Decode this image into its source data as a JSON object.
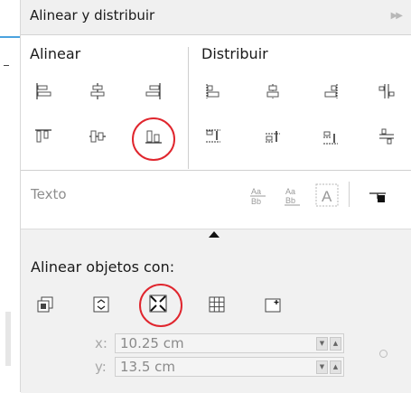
{
  "panel": {
    "title": "Alinear y distribuir",
    "collapse_icon": "chevrons-right-icon"
  },
  "sections": {
    "align_label": "Alinear",
    "distribute_label": "Distribuir",
    "text_label": "Texto",
    "align_with_label": "Alinear objetos con:"
  },
  "align_buttons": [
    {
      "name": "align-left",
      "icon": "align-left-icon"
    },
    {
      "name": "align-center-horizontal",
      "icon": "align-center-horizontal-icon"
    },
    {
      "name": "align-right",
      "icon": "align-right-icon"
    },
    {
      "name": "align-top",
      "icon": "align-top-icon"
    },
    {
      "name": "align-center-vertical",
      "icon": "align-center-vertical-icon"
    },
    {
      "name": "align-bottom",
      "icon": "align-bottom-icon",
      "highlighted": true
    }
  ],
  "distribute_buttons": [
    {
      "name": "distribute-left",
      "icon": "distribute-left-icon"
    },
    {
      "name": "distribute-center-h",
      "icon": "distribute-center-horizontal-icon"
    },
    {
      "name": "distribute-right",
      "icon": "distribute-right-icon"
    },
    {
      "name": "distribute-spacing-h",
      "icon": "distribute-spacing-horizontal-icon"
    },
    {
      "name": "distribute-top",
      "icon": "distribute-top-icon"
    },
    {
      "name": "distribute-center-v",
      "icon": "distribute-center-vertical-icon"
    },
    {
      "name": "distribute-bottom",
      "icon": "distribute-bottom-icon"
    },
    {
      "name": "distribute-spacing-v",
      "icon": "distribute-spacing-vertical-icon"
    }
  ],
  "text_buttons": [
    {
      "name": "first-line-baseline",
      "icon": "text-baseline-icon",
      "glyph": "Aa Bb"
    },
    {
      "name": "last-line-baseline",
      "icon": "text-last-baseline-icon",
      "glyph": "Aa Bb"
    },
    {
      "name": "text-bounding-box",
      "icon": "text-bounding-box-icon",
      "glyph": "A"
    },
    {
      "name": "outline",
      "icon": "outline-icon"
    }
  ],
  "align_with_buttons": [
    {
      "name": "active-objects",
      "icon": "active-objects-icon"
    },
    {
      "name": "page-edge",
      "icon": "page-edge-icon"
    },
    {
      "name": "page-center",
      "icon": "page-center-icon",
      "highlighted": true
    },
    {
      "name": "grid",
      "icon": "grid-icon"
    },
    {
      "name": "specified-point",
      "icon": "specified-point-icon"
    }
  ],
  "coordinates": {
    "x": {
      "label": "x:",
      "value": "10.25 cm"
    },
    "y": {
      "label": "y:",
      "value": "13.5 cm"
    }
  },
  "colors": {
    "highlight_circle": "#e0262e",
    "accent_edge": "#4aa3df",
    "text_disabled": "#8e8e8e"
  }
}
